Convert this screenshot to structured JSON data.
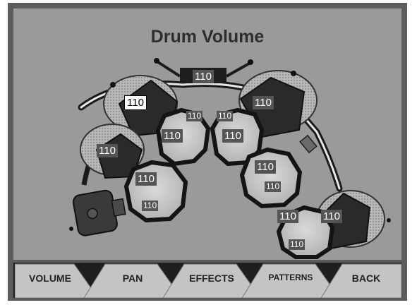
{
  "screen": {
    "title": "Drum Volume"
  },
  "colors": {
    "frame": "#5c5c5c",
    "screen": "#9a9a9a",
    "tab": "#c4c4c4",
    "value_bg": "#555555",
    "selected_bg": "#ffffff"
  },
  "drums": [
    {
      "id": "bass-drum",
      "value": "110"
    },
    {
      "id": "crash-cymbal-left",
      "value": "110",
      "selected": true
    },
    {
      "id": "hihat-cymbal",
      "value": "110"
    },
    {
      "id": "crash-cymbal-right",
      "value": "110"
    },
    {
      "id": "ride-cymbal",
      "value": "110"
    },
    {
      "id": "tom-1-head",
      "value": "110"
    },
    {
      "id": "tom-1-rim",
      "value": "110"
    },
    {
      "id": "tom-2-head",
      "value": "110"
    },
    {
      "id": "tom-2-rim",
      "value": "110"
    },
    {
      "id": "snare-head",
      "value": "110"
    },
    {
      "id": "snare-rim",
      "value": "110"
    },
    {
      "id": "tom-3-head",
      "value": "110"
    },
    {
      "id": "tom-3-rim",
      "value": "110"
    },
    {
      "id": "floor-tom-head",
      "value": "110"
    },
    {
      "id": "floor-tom-rim",
      "value": "110"
    }
  ],
  "nav": {
    "volume": "VOLUME",
    "pan": "PAN",
    "effects": "EFFECTS",
    "patterns": "PATTERNS",
    "back": "BACK"
  }
}
